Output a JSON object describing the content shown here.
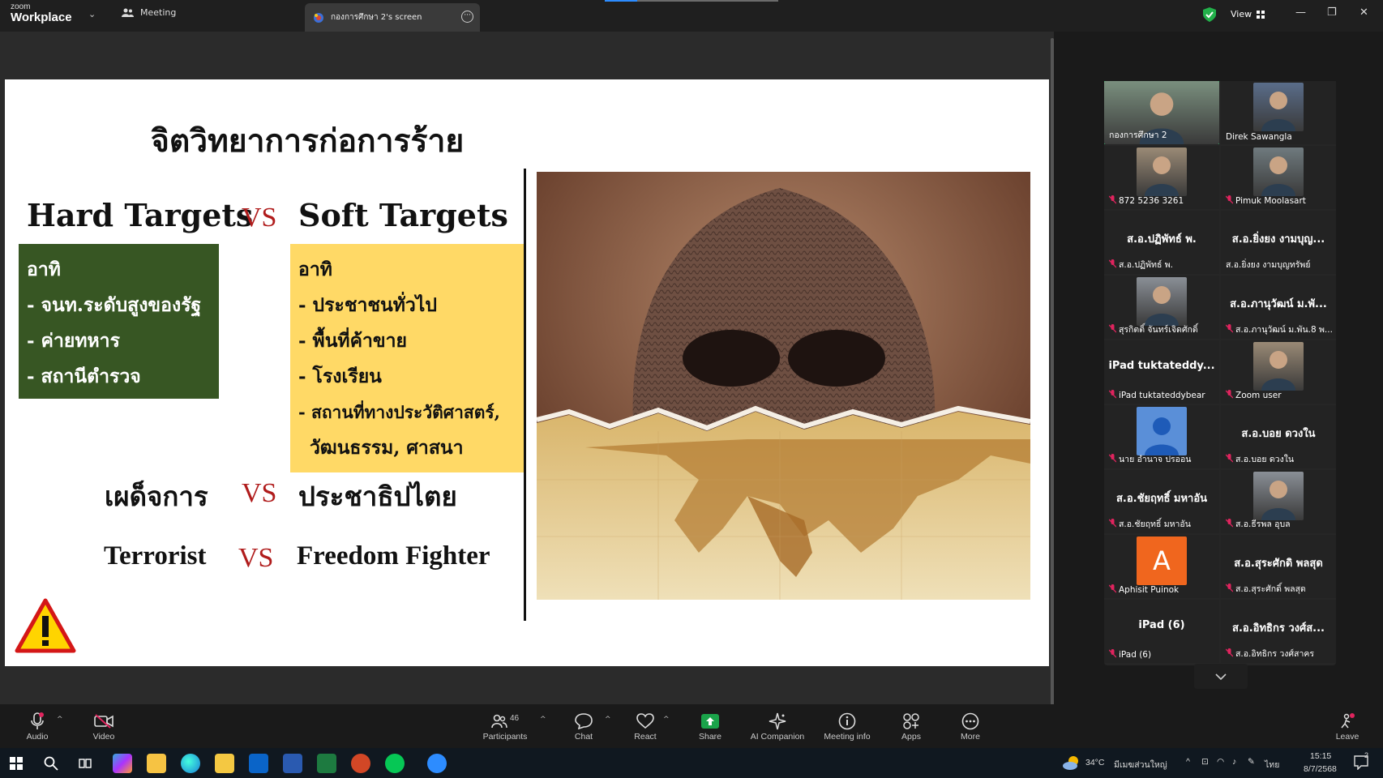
{
  "titlebar": {
    "brand_line1": "zoom",
    "brand_line2": "Workplace",
    "meeting_tab": "Meeting",
    "share_tab": "กองการศึกษา 2's screen",
    "view_label": "View"
  },
  "slide": {
    "title": "จิตวิทยาการก่อการร้าย",
    "hard_targets": "Hard Targets",
    "vs": "VS",
    "soft_targets": "Soft Targets",
    "hard_list": [
      "อาทิ",
      "- จนท.ระดับสูงของรัฐ",
      "- ค่ายทหาร",
      "- สถานีตำรวจ"
    ],
    "soft_list": [
      "อาทิ",
      "- ประชาชนทั่วไป",
      "- พื้นที่ค้าขาย",
      "- โรงเรียน",
      "- สถานที่ทางประวัติศาสตร์,",
      "วัฒนธรรม, ศาสนา"
    ],
    "row2_left": "เผด็จการ",
    "row2_vs": "VS",
    "row2_right": "ประชาธิปไตย",
    "row3_left": "Terrorist",
    "row3_vs": "VS",
    "row3_right": "Freedom Fighter"
  },
  "gallery": {
    "tiles": [
      {
        "name": "กองการศึกษา 2",
        "big": "",
        "kind": "photo-active",
        "muted": false
      },
      {
        "name": "Direk Sawangla",
        "big": "",
        "kind": "photo",
        "muted": false
      },
      {
        "name": "872 5236 3261",
        "big": "",
        "kind": "photo",
        "muted": true
      },
      {
        "name": "Pimuk Moolasart",
        "big": "",
        "kind": "photo",
        "muted": true
      },
      {
        "name": "ส.อ.ปฏิพัทธ์ พ.",
        "big": "ส.อ.ปฏิพัทธ์ พ.",
        "kind": "text",
        "muted": true
      },
      {
        "name": "ส.อ.ยิ่งยง งามบุญทรัพย์",
        "big": "ส.อ.ยิ่งยง งามบุญ...",
        "kind": "text",
        "muted": false
      },
      {
        "name": "สุรกิตติ์ จันทร์เจิดศักดิ์",
        "big": "",
        "kind": "photo",
        "muted": true
      },
      {
        "name": "ส.อ.ภานุวัฒน์ ม.พัน.8 พ...",
        "big": "ส.อ.ภานุวัฒน์ ม.พั...",
        "kind": "text",
        "muted": true
      },
      {
        "name": "iPad tuktateddybear",
        "big": "iPad  tuktateddy...",
        "kind": "text",
        "muted": true
      },
      {
        "name": "Zoom user",
        "big": "",
        "kind": "photo",
        "muted": true
      },
      {
        "name": "นาย อำนาจ ปรออน",
        "big": "",
        "kind": "avatar",
        "muted": true
      },
      {
        "name": "ส.อ.บอย ดวงใน",
        "big": "ส.อ.บอย ดวงใน",
        "kind": "text",
        "muted": true
      },
      {
        "name": "ส.อ.ชัยฤทธิ์ มหาอัน",
        "big": "ส.อ.ชัยฤทธิ์ มหาอัน",
        "kind": "text",
        "muted": true
      },
      {
        "name": "ส.อ.ธีรพล อุบล",
        "big": "",
        "kind": "photo",
        "muted": true
      },
      {
        "name": "Aphisit Puinok",
        "big": "A",
        "kind": "letter",
        "muted": true
      },
      {
        "name": "ส.อ.สุระศักดิ์ พลสุด",
        "big": "ส.อ.สุระศักดิ พลสุด",
        "kind": "text",
        "muted": true
      },
      {
        "name": "iPad (6)",
        "big": "iPad (6)",
        "kind": "text",
        "muted": true
      },
      {
        "name": "ส.อ.อิทธิกร วงศ์สาคร",
        "big": "ส.อ.อิทธิกร วงศ์ส...",
        "kind": "text",
        "muted": true
      }
    ]
  },
  "toolbar": {
    "audio": "Audio",
    "video": "Video",
    "participants": "Participants",
    "participants_count": "46",
    "chat": "Chat",
    "react": "React",
    "share": "Share",
    "ai": "AI Companion",
    "info": "Meeting info",
    "apps": "Apps",
    "more": "More",
    "leave": "Leave"
  },
  "taskbar": {
    "weather_temp": "34°C",
    "weather_desc": "มีเมฆส่วนใหญ่",
    "lang": "ไทย",
    "time": "15:15",
    "date": "8/7/2568",
    "notif_count": "2"
  },
  "colors": {
    "green_box": "#375623",
    "yellow_box": "#ffd966",
    "vs_red": "#b01c1c",
    "active_speaker": "#2dc66c",
    "share_green": "#1aa34a"
  }
}
